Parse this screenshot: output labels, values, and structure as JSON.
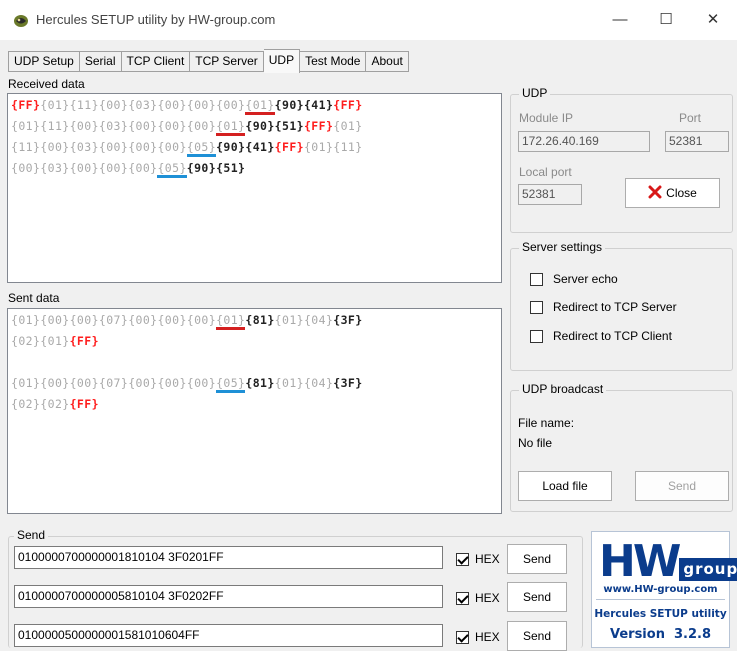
{
  "window": {
    "title": "Hercules SETUP utility by HW-group.com",
    "min_glyph": "—",
    "max_glyph": "☐",
    "close_glyph": "✕"
  },
  "tabs": [
    "UDP Setup",
    "Serial",
    "TCP Client",
    "TCP Server",
    "UDP",
    "Test Mode",
    "About"
  ],
  "active_tab": "UDP",
  "received": {
    "label": "Received data",
    "lines": [
      [
        {
          "t": "{FF}",
          "c": "r"
        },
        {
          "t": "{01}",
          "c": "g"
        },
        {
          "t": "{11}",
          "c": "g"
        },
        {
          "t": "{00}",
          "c": "g"
        },
        {
          "t": "{03}",
          "c": "g"
        },
        {
          "t": "{00}",
          "c": "g"
        },
        {
          "t": "{00}",
          "c": "g"
        },
        {
          "t": "{00}",
          "c": "g"
        },
        {
          "t": "{01}",
          "c": "g",
          "u": "red"
        },
        {
          "t": "{90}",
          "c": "b"
        },
        {
          "t": "{41}",
          "c": "b"
        },
        {
          "t": "{FF}",
          "c": "r"
        }
      ],
      [
        {
          "t": "{01}",
          "c": "g"
        },
        {
          "t": "{11}",
          "c": "g"
        },
        {
          "t": "{00}",
          "c": "g"
        },
        {
          "t": "{03}",
          "c": "g"
        },
        {
          "t": "{00}",
          "c": "g"
        },
        {
          "t": "{00}",
          "c": "g"
        },
        {
          "t": "{00}",
          "c": "g"
        },
        {
          "t": "{01}",
          "c": "g",
          "u": "red"
        },
        {
          "t": "{90}",
          "c": "b"
        },
        {
          "t": "{51}",
          "c": "b"
        },
        {
          "t": "{FF}",
          "c": "r"
        },
        {
          "t": "{01}",
          "c": "g"
        }
      ],
      [
        {
          "t": "{11}",
          "c": "g"
        },
        {
          "t": "{00}",
          "c": "g"
        },
        {
          "t": "{03}",
          "c": "g"
        },
        {
          "t": "{00}",
          "c": "g"
        },
        {
          "t": "{00}",
          "c": "g"
        },
        {
          "t": "{00}",
          "c": "g"
        },
        {
          "t": "{05}",
          "c": "g",
          "u": "blue"
        },
        {
          "t": "{90}",
          "c": "b"
        },
        {
          "t": "{41}",
          "c": "b"
        },
        {
          "t": "{FF}",
          "c": "r"
        },
        {
          "t": "{01}",
          "c": "g"
        },
        {
          "t": "{11}",
          "c": "g"
        }
      ],
      [
        {
          "t": "{00}",
          "c": "g"
        },
        {
          "t": "{03}",
          "c": "g"
        },
        {
          "t": "{00}",
          "c": "g"
        },
        {
          "t": "{00}",
          "c": "g"
        },
        {
          "t": "{00}",
          "c": "g"
        },
        {
          "t": "{05}",
          "c": "g",
          "u": "blue"
        },
        {
          "t": "{90}",
          "c": "b"
        },
        {
          "t": "{51}",
          "c": "b"
        }
      ]
    ]
  },
  "sent": {
    "label": "Sent data",
    "lines": [
      [
        {
          "t": "{01}",
          "c": "g"
        },
        {
          "t": "{00}",
          "c": "g"
        },
        {
          "t": "{00}",
          "c": "g"
        },
        {
          "t": "{07}",
          "c": "g"
        },
        {
          "t": "{00}",
          "c": "g"
        },
        {
          "t": "{00}",
          "c": "g"
        },
        {
          "t": "{00}",
          "c": "g"
        },
        {
          "t": "{01}",
          "c": "g",
          "u": "red"
        },
        {
          "t": "{81}",
          "c": "b"
        },
        {
          "t": "{01}",
          "c": "g"
        },
        {
          "t": "{04}",
          "c": "g"
        },
        {
          "t": "{3F}",
          "c": "b"
        }
      ],
      [
        {
          "t": "{02}",
          "c": "g"
        },
        {
          "t": "{01}",
          "c": "g"
        },
        {
          "t": "{FF}",
          "c": "r"
        }
      ],
      [],
      [
        {
          "t": "{01}",
          "c": "g"
        },
        {
          "t": "{00}",
          "c": "g"
        },
        {
          "t": "{00}",
          "c": "g"
        },
        {
          "t": "{07}",
          "c": "g"
        },
        {
          "t": "{00}",
          "c": "g"
        },
        {
          "t": "{00}",
          "c": "g"
        },
        {
          "t": "{00}",
          "c": "g"
        },
        {
          "t": "{05}",
          "c": "g",
          "u": "blue"
        },
        {
          "t": "{81}",
          "c": "b"
        },
        {
          "t": "{01}",
          "c": "g"
        },
        {
          "t": "{04}",
          "c": "g"
        },
        {
          "t": "{3F}",
          "c": "b"
        }
      ],
      [
        {
          "t": "{02}",
          "c": "g"
        },
        {
          "t": "{02}",
          "c": "g"
        },
        {
          "t": "{FF}",
          "c": "r"
        }
      ]
    ]
  },
  "udp": {
    "title": "UDP",
    "module_ip_label": "Module IP",
    "module_ip": "172.26.40.169",
    "port_label": "Port",
    "port": "52381",
    "local_port_label": "Local port",
    "local_port": "52381",
    "close_label": "Close",
    "close_icon": "red-x-icon"
  },
  "server_settings": {
    "title": "Server settings",
    "items": [
      {
        "label": "Server echo",
        "checked": false
      },
      {
        "label": "Redirect to TCP Server",
        "checked": false
      },
      {
        "label": "Redirect to TCP Client",
        "checked": false
      }
    ]
  },
  "broadcast": {
    "title": "UDP broadcast",
    "file_name_label": "File name:",
    "file_name": "No file",
    "load_label": "Load file",
    "send_label": "Send"
  },
  "send": {
    "title": "Send",
    "hex_label": "HEX",
    "button_label": "Send",
    "rows": [
      {
        "value": "0100000700000001810104 3F0201FF",
        "hex": true
      },
      {
        "value": "0100000700000005810104 3F0202FF",
        "hex": true
      },
      {
        "value": "0100000500000001581010604FF",
        "hex": true
      }
    ]
  },
  "logo": {
    "letters_big": "HW",
    "letters_small": "group",
    "url": "www.HW-group.com",
    "product": "Hercules SETUP utility",
    "version": "Version  3.2.8"
  },
  "colors": {
    "accent_red": "#d42020",
    "accent_blue": "#1e90d6",
    "logo_blue": "#0b3c8c"
  }
}
